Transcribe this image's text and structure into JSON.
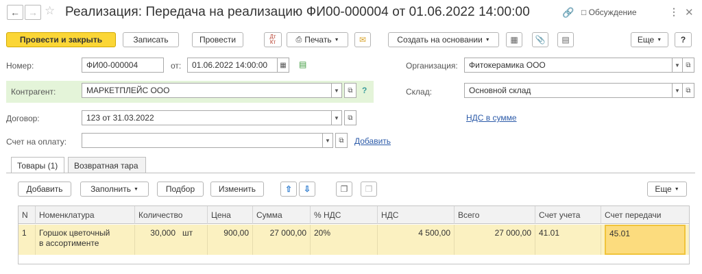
{
  "title": "Реализация: Передача на реализацию ФИ00-000004 от 01.06.2022 14:00:00",
  "titlebar": {
    "discuss_label": "Обсуждение"
  },
  "toolbar": {
    "post_close": "Провести и закрыть",
    "save": "Записать",
    "post": "Провести",
    "dtkt": "Дт Кт",
    "print": "Печать",
    "create_based": "Создать на основании",
    "more": "Еще",
    "help": "?"
  },
  "form": {
    "number_label": "Номер:",
    "number": "ФИ00-000004",
    "date_label": "от:",
    "date": "01.06.2022 14:00:00",
    "org_label": "Организация:",
    "org": "Фитокерамика ООО",
    "contractor_label": "Контрагент:",
    "contractor": "МАРКЕТПЛЕЙС ООО",
    "warehouse_label": "Склад:",
    "warehouse": "Основной склад",
    "contract_label": "Договор:",
    "contract": "123 от 31.03.2022",
    "vat_link": "НДС в сумме",
    "invoice_label": "Счет на оплату:",
    "invoice": "",
    "add_link": "Добавить",
    "help_q": "?"
  },
  "tabs": [
    {
      "label": "Товары (1)",
      "active": true
    },
    {
      "label": "Возвратная тара",
      "active": false
    }
  ],
  "table_toolbar": {
    "add": "Добавить",
    "fill": "Заполнить",
    "pick": "Подбор",
    "change": "Изменить",
    "more": "Еще"
  },
  "table": {
    "columns": [
      "N",
      "Номенклатура",
      "Количество",
      "Цена",
      "Сумма",
      "% НДС",
      "НДС",
      "Всего",
      "Счет учета",
      "Счет передачи"
    ],
    "rows": [
      {
        "n": "1",
        "item": "Горшок цветочный в ассортименте",
        "qty": "30,000",
        "unit": "шт",
        "price": "900,00",
        "sum": "27 000,00",
        "vat_rate": "20%",
        "vat": "4 500,00",
        "total": "27 000,00",
        "account": "41.01",
        "transfer_account": "45.01"
      }
    ]
  },
  "colors": {
    "primary_button": "#fbd636",
    "selected_row": "#fbf1c1",
    "link": "#2b5aa8",
    "highlight_row": "#e4f4d9"
  }
}
